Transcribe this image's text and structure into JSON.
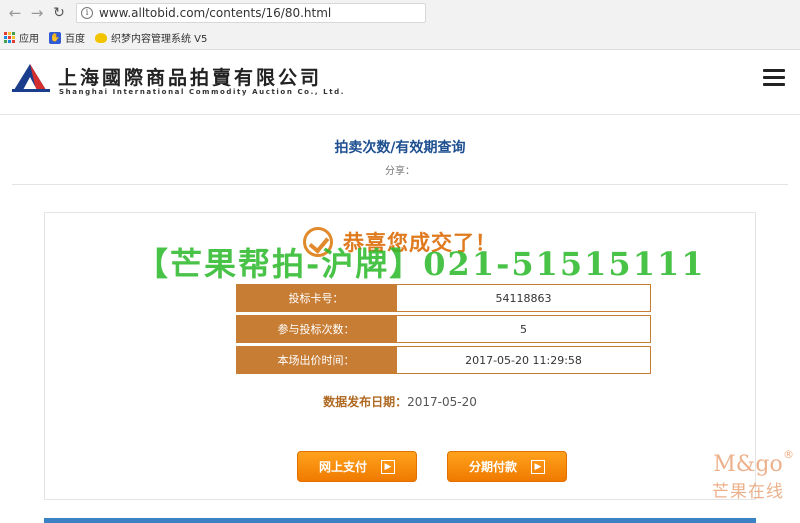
{
  "browser": {
    "url": "www.alltobid.com/contents/16/80.html",
    "bookmarks": [
      {
        "label": "应用",
        "icon": "apps-icon"
      },
      {
        "label": "百度",
        "icon": "baidu-icon"
      },
      {
        "label": "织梦内容管理系统 V5",
        "icon": "dedecms-icon"
      }
    ]
  },
  "header": {
    "logo_cn": "上海國際商品拍賣有限公司",
    "logo_en": "Shanghai International Commodity Auction Co., Ltd."
  },
  "page": {
    "title": "拍卖次数/有效期查询",
    "share": "分享："
  },
  "result": {
    "congrats": "恭喜您成交了！",
    "watermark": "【芒果帮拍-沪牌】021-51515111",
    "rows": [
      {
        "label": "投标卡号：",
        "value": "54118863"
      },
      {
        "label": "参与投标次数：",
        "value": "5"
      },
      {
        "label": "本场出价时间：",
        "value": "2017-05-20 11:29:58"
      }
    ],
    "pubdate_label": "数据发布日期：",
    "pubdate_value": "2017-05-20"
  },
  "buttons": {
    "online_pay": "网上支付",
    "installment": "分期付款"
  },
  "corner_logo": {
    "en": "M&go",
    "reg": "®",
    "cn": "芒果在线"
  },
  "colors": {
    "accent": "#c87d35",
    "button": "#f28a0c",
    "title": "#1d4f91",
    "watermark": "#28b928"
  }
}
